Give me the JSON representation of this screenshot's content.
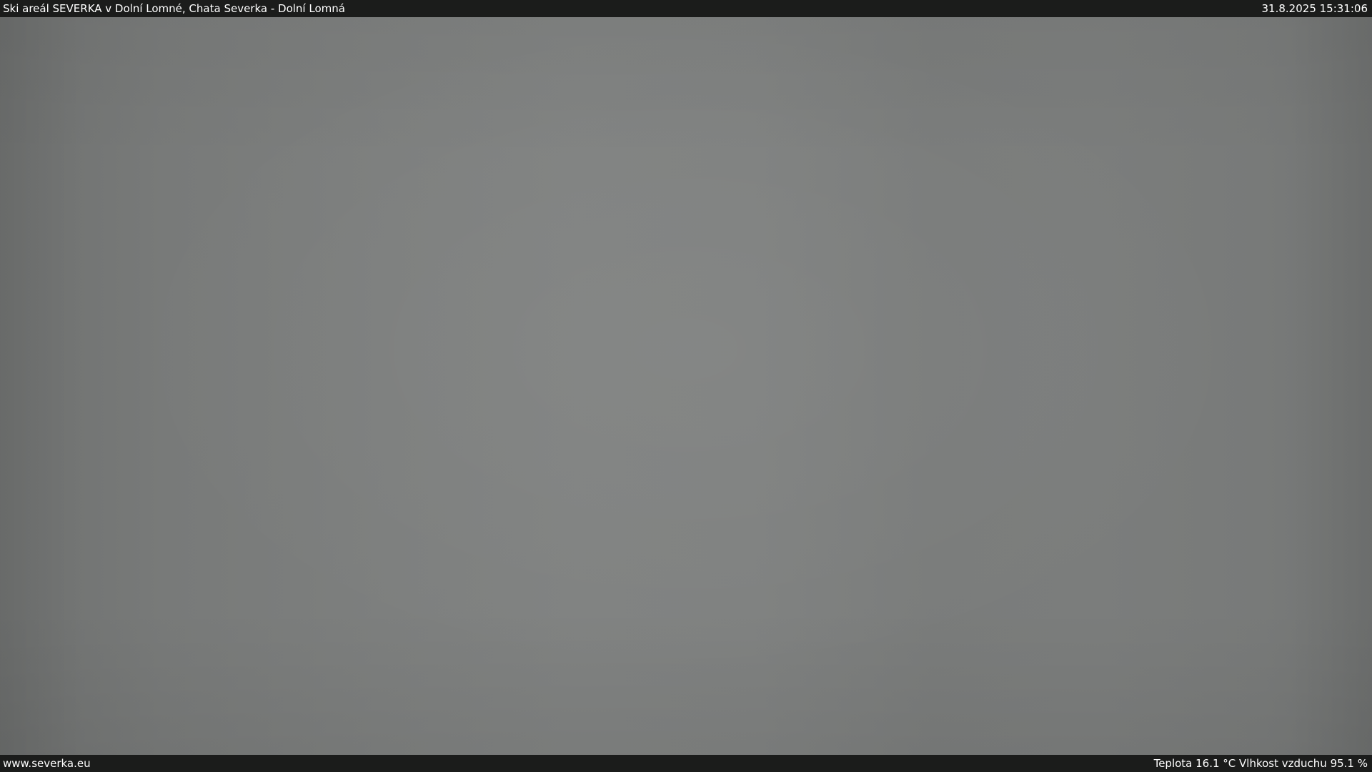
{
  "header": {
    "title": "Ski areál SEVERKA v Dolní Lomné, Chata Severka - Dolní Lomná",
    "datetime": "31.8.2025 15:31:06"
  },
  "footer": {
    "website": "www.severka.eu",
    "weather": "Teplota 16.1 °C Vlhkost vzduchu 95.1 %"
  },
  "colors": {
    "bar_background": "#1b1c1b",
    "bar_text": "#ffffff",
    "image_fog_gray": "#7d7f7e"
  }
}
